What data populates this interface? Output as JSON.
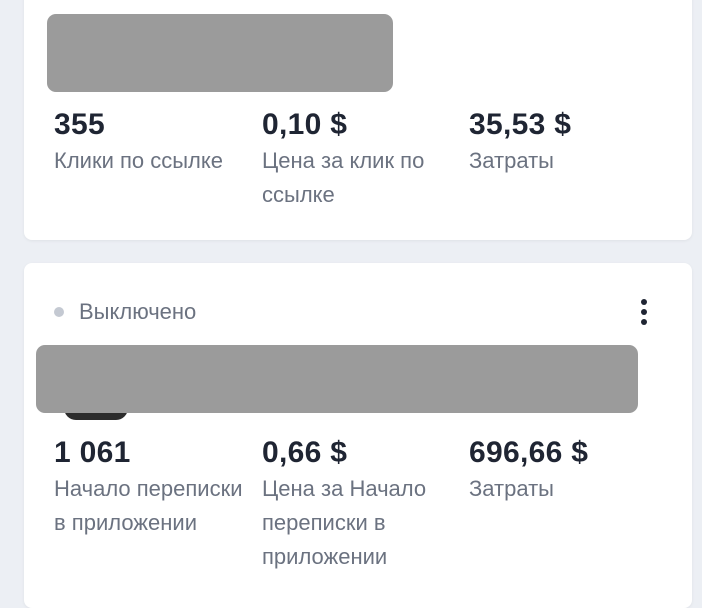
{
  "card1": {
    "stats": [
      {
        "value": "355",
        "label": "Клики по ссылке"
      },
      {
        "value": "0,10 $",
        "label": "Цена за клик по ссылке"
      },
      {
        "value": "35,53 $",
        "label": "Затраты"
      }
    ]
  },
  "card2": {
    "status": "Выключено",
    "stats": [
      {
        "value": "1 061",
        "label": "Начало переписки в приложении"
      },
      {
        "value": "0,66 $",
        "label": "Цена за Начало переписки в приложении"
      },
      {
        "value": "696,66 $",
        "label": "Затраты"
      }
    ]
  },
  "colors": {
    "value_text": "#1f2533",
    "label_text": "#6b7280",
    "status_dot": "#c4c9d2",
    "redaction": "#9b9b9b",
    "background": "#eceff4"
  },
  "icons": {
    "more": "vertical-ellipsis-icon",
    "status": "status-dot-icon"
  }
}
